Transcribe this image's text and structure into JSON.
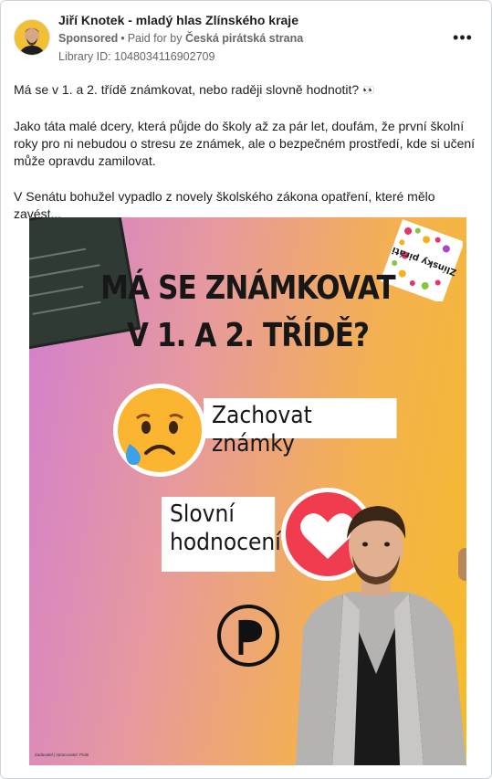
{
  "post": {
    "author": "Jiří Knotek - mladý hlas Zlínského kraje",
    "sponsored": "Sponsored",
    "paid_for_prefix": "Paid for by",
    "payer": "Česká pirátská strana",
    "library_id": "Library ID: 1048034116902709",
    "more_icon": "more-dots-icon",
    "paragraphs": [
      "Má se v 1. a 2. třídě známkovat, nebo raději slovně hodnotit?",
      "Jako táta malé dcery, která půjde do školy až za pár let, doufám, že první školní roky pro ni nebudou o stresu ze známek, ale o bezpečném prostředí, kde si učení může opravdu zamilovat.",
      "V Senátu bohužel vypadlo z novely školského zákona opatření, které mělo zavést..."
    ],
    "eyes_glyph": "👀"
  },
  "ad_image": {
    "headline_line1": "MÁ SE ZNÁMKOVAT",
    "headline_line2": "V 1. A 2. TŘÍDĚ?",
    "option1": "Zachovat známky",
    "option2_line1": "Slovní",
    "option2_line2": "hodnocení",
    "sticker_text": "Zlínsky piráti",
    "footer": "Zadavatel | zpracovatel: Piráti",
    "colors": {
      "gradient_left": "#d27ed0",
      "gradient_right": "#f5bb2a",
      "heart_red": "#f03c4e",
      "emoji_yellow": "#fbb531"
    }
  }
}
